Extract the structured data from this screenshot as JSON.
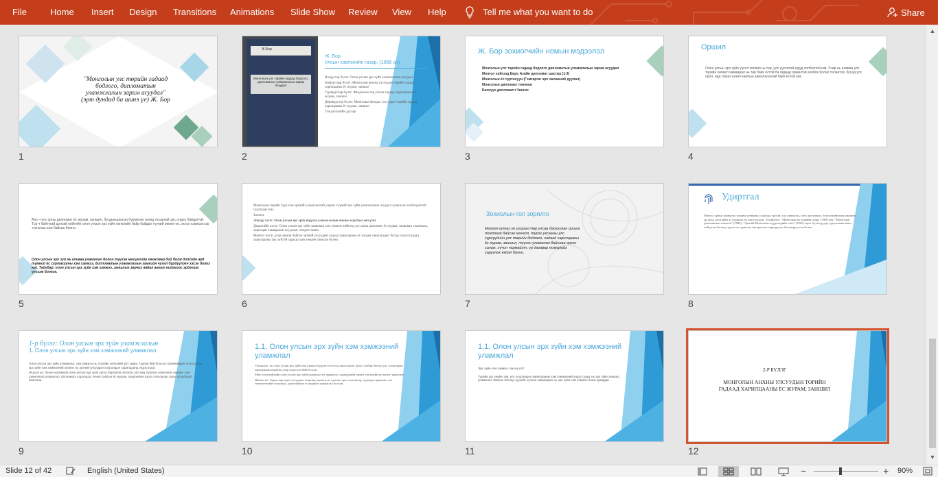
{
  "ribbon": {
    "tabs": [
      "File",
      "Home",
      "Insert",
      "Design",
      "Transitions",
      "Animations",
      "Slide Show",
      "Review",
      "View",
      "Help"
    ],
    "tell_me": "Tell me what you want to do",
    "share": "Share",
    "accent": "#c43e1c"
  },
  "status": {
    "slide_info": "Slide 12 of 42",
    "language": "English (United States)",
    "zoom": "90%",
    "zoom_minus": "−",
    "zoom_plus": "+"
  },
  "slides": [
    {
      "num": "1",
      "lines": [
        "\"Монголын улс төрийн гадаад",
        "бодлого, дипломатын",
        "уламжлалын зарим асуудал\"",
        "(эрт дундад ба шинэ үе) Ж. Бор"
      ]
    },
    {
      "num": "2",
      "title": "Ж. Бор",
      "subtitle": "Улсын хэвлэлийн газар, (1988 он)",
      "book": "Ж.Бор",
      "book_title": "Монголын улс төрийн гадаад бодлого, дипломатын уламжлалын зарим асуудал",
      "bullets": [
        "Нэгдүгээр бүлэг: Олон улсын эрх зүйн уламжлалын асуудал",
        "Хоёрдугаар бүлэг: Монголын анхны улсуудын төрийн гадаад харилцааны ёс журам, заншил",
        "Гуравдугаар бүлэг: Феодалын төр улсын гадаад харилцааны ёс журам, заншил",
        "Дөрөвдүгээр бүлэг: Монголын феодал улсуудын төрийн гадаад харилцааны ёс журам, заншил",
        "Тэмдэглэлийн дугаар"
      ]
    },
    {
      "num": "3",
      "title": "Ж. Бор зохиогчийн номын мэдээлэл",
      "bullets": [
        "Монголын улс төрийн гадаад бодлого дипломатын уламжлалын зарим асуудал",
        "Монгол хийгээд Евро Азийн дипломат шастир (1-3)",
        "Монголын ёс суртахуун (Гэмгаргаг эрх чөлөөний дуулал)",
        "Монголын дипломат товчоон",
        "Билгүүн дипломатч Чингис"
      ]
    },
    {
      "num": "4",
      "title": "Оршил",
      "body": "Олон улсын эрх зүйн үүсэл хөгжил нь төр, улс үүсэлтэй шууд холбоотой юм. Учир нь аливаа улс төрийн хөгжил хамаарал нь төр байх ёстой ба гадаад орчинтой холбох болно төлөвтэй, бусад улс орон, ард түмэн хүчин хамтын ажиллагаатай байх ёстой юм."
    },
    {
      "num": "5",
      "body1": "Аль ч улс орны дипломат ёс журам, заншил, бусдыншаасан бүрмөсөн ангид тасархай эрс ондоо байдаггүй. Тэр ч байтугай дэлхий нийтийн олон улсын эрх зүйн хөгжлийн байр байдал түүний өмнөх үе, эхлэх хэмжээгээр тусгалаа олж байсан болно.",
      "body2": "Олон улсын эрх зүй нь аливаа уламжлал болон түүхэн нөхцөлийн хөгжлөөр бий болж дэлхийн ард түмний ёс суртахууны хэм хэмжээ, дипломатын уламжлалын хамгийн чухал бүрдүүлэгч хэсэг болох юм. Тайлбар: олон улсын эрх зүйн хэм хэмжээ, заншлыг зөрчих явдал ангит нийгмээс эрдэнээс үүсгэж болгох."
    },
    {
      "num": "6",
      "bullets": [
        "Монголын төрийн түүх нэн эртний уламжлалтай учраас түүний эрх зүйн уламжлалын асуудал үлэмж ач холбогдолтой судлагдах юм.",
        "Зохиол:",
        "Энэхүү хэсэг: Олон улсын эрх зүйн түүхэн уламжлалын анхны асуудлыг авч үзнэ",
        "Дараагийн хэсэг: Олон улсын эрх зүйн заншлын хэм хэмжээ хийгээд улс орны дипломат ёс журам, заншлын уламжлал, харилцан хамаарлын асуудлыг хөндөн тавих.",
        "Монгол нутаг дээр оршин байсан эртний улсуудын гадаад харилцааны ёс журам заншлуудыг бусад улсын гадаад харилцааны эрх зүйтэй харьцуулан хөндөн тавьсан болно."
      ]
    },
    {
      "num": "7",
      "title": "Зохиолын гол зорилго",
      "body": "Монгол нутаг үе улиран төр улсаа байгуулан оршин тогтнож байсан монгол, түрэг угсааны улс гүрнүүдийн улс төрийн бодлого, гадаад харилцааны ёс журам, заншил, түүхэн уламжлал байснаа эргэн санаж, хүчин чармайлт, үр дагавар тэмцлийг харуулах явдал болно."
    },
    {
      "num": "8",
      "title": "Удиртгал",
      "body": "Монгол орныг шинжлэх ухааны түвшинд судлахад түүхэн, хэл шинжлэл, соёл, иргэншил, бүтээлчийн ажиллагааны үр дүнд хөгжлийн эх сурвалж нь хэрэглэгддэг. Тухайлбал: \"Монголын их эзэдийн газар\" (1968 он), \"Монголын дипломатын товчоон\" (1982), \"Эртний Монголын нүүдэлчдийн соёл\" (1981) зэрэг бүтээлүүдэд судалгааны ажил хийгдсэн бөгөөд түүхэн эх сурвалж, материалыг харьцуулан боловсруулсан болно."
    },
    {
      "num": "9",
      "title": "1-р бүлэг: Олон улсын эрх зүйн уламжлалын",
      "subtitle": "1. Олон улсын эрх зүйн хэм хэмжээний уламжлал",
      "bullets": [
        "Олон улсын эрх зүйн уламжлал, хэм хэмжээ нь түүхийн хөгжлийн урт замыг туулан бий болсон. Ерөнхийдөө олон улсын эрх зүйн хэм хэмжээний хөгжил нь эртний улсуудын хоорондын харилцаанд үндэслэдэг.",
        "Жишээ нь: болон нийгмийн олон улсын эрх зүйн үүсэл бүрэлдэн тогтох үйл явц хийгээд хөгжлийн зарчим, хэм хэмжээний уламжлал, дипломат харилцаа, элчин сайдын ёс журам, хоорондын гэрээ хэлэлцээр зэрэг асуудлууд багтана."
      ]
    },
    {
      "num": "10",
      "title": "1.1. Олон улсын эрх зүйн хэм хэмжээний уламжлал",
      "bullets": [
        "Уламжлал: нь олон улсын эрх зүйн хэм хэмжээ бүрдэн тогтоход хэрэглэгдэх чухал хэлбэр бөгөөд улс хоорондын харилцааны практик дээр үндэслэн бий болсон.",
        "Мөн олон нийтийн олон улсын эрх зүйн уламжлал нь зарим улс гүрнүүдийн өмнөх хөгжлийн үе шатыг харуулна.",
        "Жишээ нь: Хөрш зэргэлдээ улсуудын хооронд гарын үсэг зурсан гэрээ хэлэлцээр, худалдаа арилжаа, элч төлөөлөгчийн солилцоо, дипломатын ёс журмын уламжлал болсон."
      ]
    },
    {
      "num": "11",
      "title": "1.1. Олон улсын эрх зүйн хэм хэмжээний уламжлал",
      "bullets": [
        "Эрх зүйн хэм хэмжээ гэж юу вэ?",
        "Тухайн цаг үеийн төр, улс хоорондын харилцааны хэм хэмжээний үндэс суурь нь эрх зүйн заншил, уламжлал байсан бөгөөд түүнийг хүлээн зөвшөөрөх нь эрх зүйн хэм хэмжээ болж хувирдаг."
      ]
    },
    {
      "num": "12",
      "line1": "2-Р БҮЛЭГ",
      "line2": "МОНГОЛЫН АНХНЫ УЛСУУДЫН ТӨРИЙН",
      "line3": "ГАДААД ХАРИЛЦААНЫ ЁС ЖУРАМ, ЗАНШИЛ"
    }
  ]
}
